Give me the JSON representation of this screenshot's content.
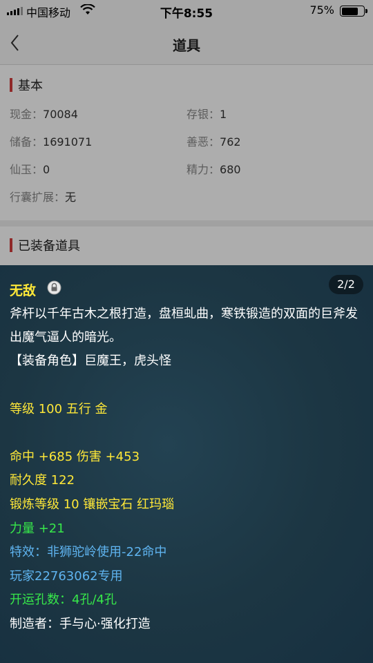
{
  "status_bar": {
    "carrier": "中国移动",
    "time": "下午8:55",
    "battery": "75%",
    "battery_level": 0.75
  },
  "nav": {
    "title": "道具"
  },
  "basic": {
    "title": "基本",
    "fields": [
      {
        "label": "现金：",
        "value": "70084"
      },
      {
        "label": "存银：",
        "value": "1"
      },
      {
        "label": "储备：",
        "value": "1691071"
      },
      {
        "label": "善恶：",
        "value": "762"
      },
      {
        "label": "仙玉：",
        "value": "0"
      },
      {
        "label": "精力：",
        "value": "680"
      },
      {
        "label": "行囊扩展：",
        "value": "无"
      }
    ]
  },
  "equipped": {
    "title": "已装备道具"
  },
  "item": {
    "name": "无敌",
    "pager": "2/2",
    "description": "斧杆以千年古木之根打造，盘桓虬曲，寒铁锻造的双面的巨斧发出魔气逼人的暗光。",
    "role": "【装备角色】巨魔王，虎头怪",
    "level_line": "等级 100 五行 金",
    "hit_line": "命中 +685 伤害 +453",
    "durability": "耐久度 122",
    "forge": "锻炼等级 10 镶嵌宝石 红玛瑙",
    "strength": "力量 +21",
    "special": "特效：非狮驼岭使用-22命中",
    "owner": "玩家22763062专用",
    "holes": "开运孔数：4孔/4孔",
    "maker": "制造者：手与心·强化打造",
    "colors": {
      "name": "#ffe838",
      "yellow": "#ffe838",
      "green": "#37e84a",
      "blue": "#5fb4f0",
      "white": "#ffffff"
    }
  }
}
